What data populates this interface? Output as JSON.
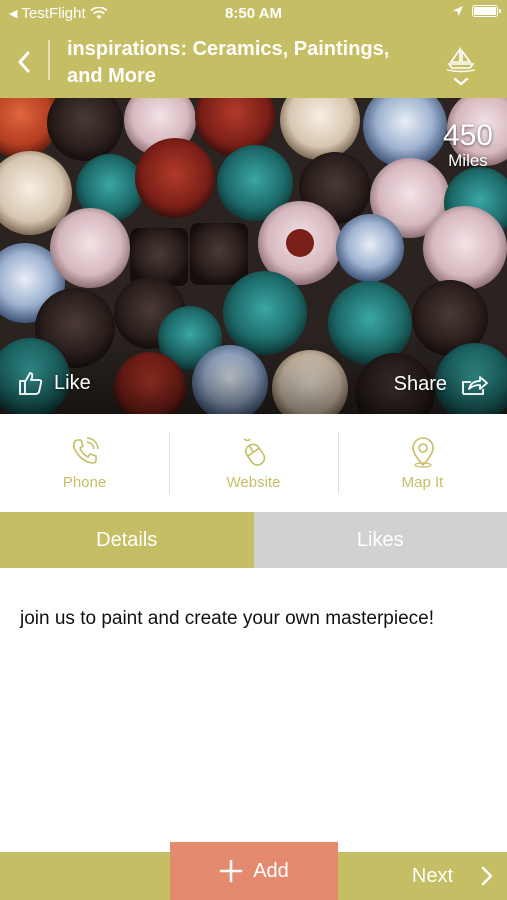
{
  "status_bar": {
    "carrier": "TestFlight",
    "time": "8:50 AM"
  },
  "header": {
    "title": "inspirations: Ceramics, Paintings, and More"
  },
  "hero": {
    "distance_value": "450",
    "distance_unit": "Miles",
    "like_label": "Like",
    "share_label": "Share"
  },
  "actions": [
    {
      "label": "Phone",
      "icon": "phone-icon"
    },
    {
      "label": "Website",
      "icon": "mouse-icon"
    },
    {
      "label": "Map It",
      "icon": "map-pin-icon"
    }
  ],
  "tabs": [
    {
      "label": "Details",
      "active": true
    },
    {
      "label": "Likes",
      "active": false
    }
  ],
  "details": {
    "description": "join us to paint and create your own masterpiece!"
  },
  "bottom": {
    "add_label": "Add",
    "next_label": "Next"
  },
  "colors": {
    "brand": "#c6be65",
    "add_button": "#e48b6f",
    "inactive_tab": "#d1d1d1"
  }
}
